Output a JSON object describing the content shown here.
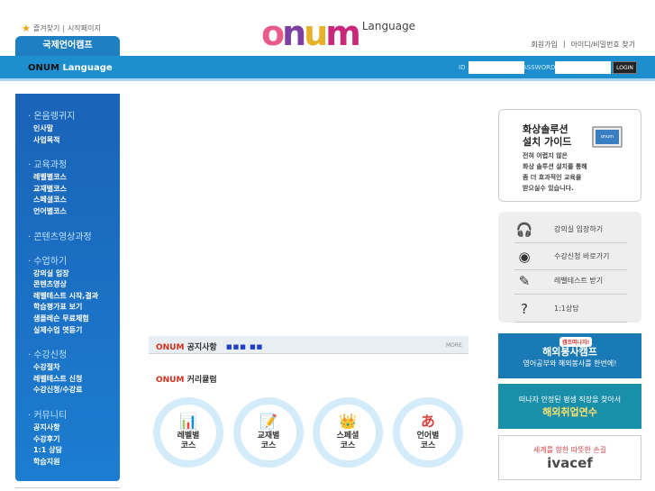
{
  "top_util": {
    "bookmark": "즐겨찾기",
    "separator": "|",
    "homepage": "시작페이지"
  },
  "camp_tab": "국제언어캠프",
  "logo": {
    "text": "onum",
    "language": "Language"
  },
  "right_util": {
    "join": "회원가입",
    "separator": "|",
    "find": "아이디/비밀번호 찾기"
  },
  "bar": {
    "brand_onum": "ONUM",
    "brand_language": "Language",
    "id_label": "ID",
    "pw_label": "ASSWORD",
    "login": "LOGIN"
  },
  "nav": {
    "sections": [
      {
        "head": "· 온음랭귀지",
        "items": [
          "인사말",
          "사업목적"
        ]
      },
      {
        "head": "· 교육과정",
        "items": [
          "레벨별코스",
          "교재별코스",
          "스페셜코스",
          "언어별코스"
        ]
      },
      {
        "head": "· 콘텐츠영상과정",
        "items": []
      },
      {
        "head": "· 수업하기",
        "items": [
          "강의실 입장",
          "콘텐츠영상",
          "레벨테스트 시작,결과",
          "학습평가표 보기",
          "샘플레슨 무료체험",
          "실제수업 엿듣기"
        ]
      },
      {
        "head": "· 수강신청",
        "items": [
          "수강절차",
          "레벨테스트 신청",
          "수강신청/수강료"
        ]
      },
      {
        "head": "· 커뮤니티",
        "items": [
          "공지사항",
          "수강후기",
          "1:1 상담",
          "학습지원"
        ]
      }
    ]
  },
  "notice": {
    "brand": "ONUM",
    "title": "공지사항",
    "dots": "■■■ ■■",
    "more": "MORE"
  },
  "curriculum": {
    "brand": "ONUM",
    "title": "커리큘럼"
  },
  "courses": [
    {
      "icon": "📊",
      "line1": "레벨별",
      "line2": "코스"
    },
    {
      "icon": "📝",
      "line1": "교재별",
      "line2": "코스"
    },
    {
      "icon": "👑",
      "line1": "스페셜",
      "line2": "코스"
    },
    {
      "icon": "あ",
      "line1": "언어별",
      "line2": "코스"
    }
  ],
  "guide": {
    "title1": "화상솔루션",
    "title2": "설치 가이드",
    "desc": [
      "전혀 어렵지 않은",
      "화상 솔루션 설치를 통해",
      "좀 더 효과적인 교육을",
      "받으실수 있습니다."
    ],
    "screen_text": "onum"
  },
  "quick": [
    {
      "icon": "headset-icon",
      "glyph": "🎧",
      "label": "강의실 입장하기"
    },
    {
      "icon": "webcam-icon",
      "glyph": "◉",
      "label": "수강신청 바로가기"
    },
    {
      "icon": "test-icon",
      "glyph": "✎",
      "label": "레벨테스트 받기"
    },
    {
      "icon": "question-icon",
      "glyph": "?",
      "label": "1:1상담"
    }
  ],
  "banners": [
    {
      "title": "해외봉사캠프",
      "sub": "영어공부와 해외봉사를 한번에!",
      "tag": "캠프떠나자!"
    },
    {
      "title": "해외취업연수",
      "sub": "떠나자 안정된 평생 직장을 찾아서"
    },
    {
      "title": "ivacef",
      "sub": "세계를 향한 따뜻한 손길"
    }
  ]
}
